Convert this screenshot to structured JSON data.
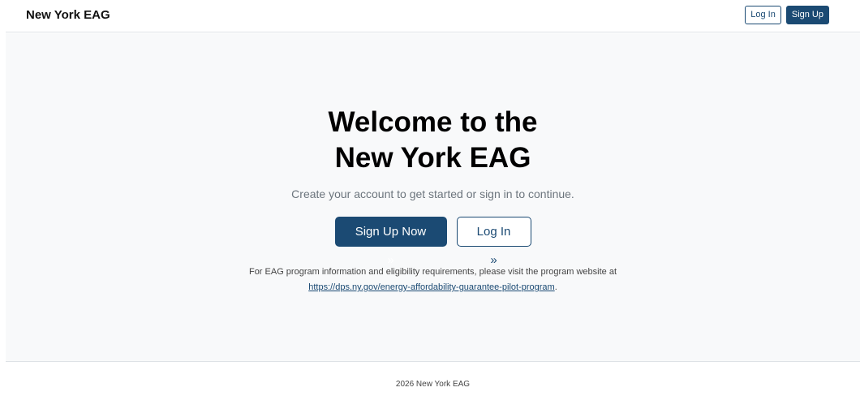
{
  "nav": {
    "brand": "New York EAG",
    "login_label": "Log In",
    "signup_label": "Sign Up"
  },
  "hero": {
    "title_line1": "Welcome to the",
    "title_line2": "New York EAG",
    "lead": "Create your account to get started or sign in to continue.",
    "signup_cta": "Sign Up Now »",
    "login_cta": "Log In »",
    "info_text": "For EAG program information and eligibility requirements, please visit the program website at",
    "info_link": "https://dps.ny.gov/energy-affordability-guarantee-pilot-program",
    "info_suffix": "."
  },
  "footer": {
    "text": "2026 New York EAG"
  },
  "colors": {
    "primary": "#1b4a73",
    "hero_bg": "#f8f9fa",
    "muted": "#6c757d"
  }
}
